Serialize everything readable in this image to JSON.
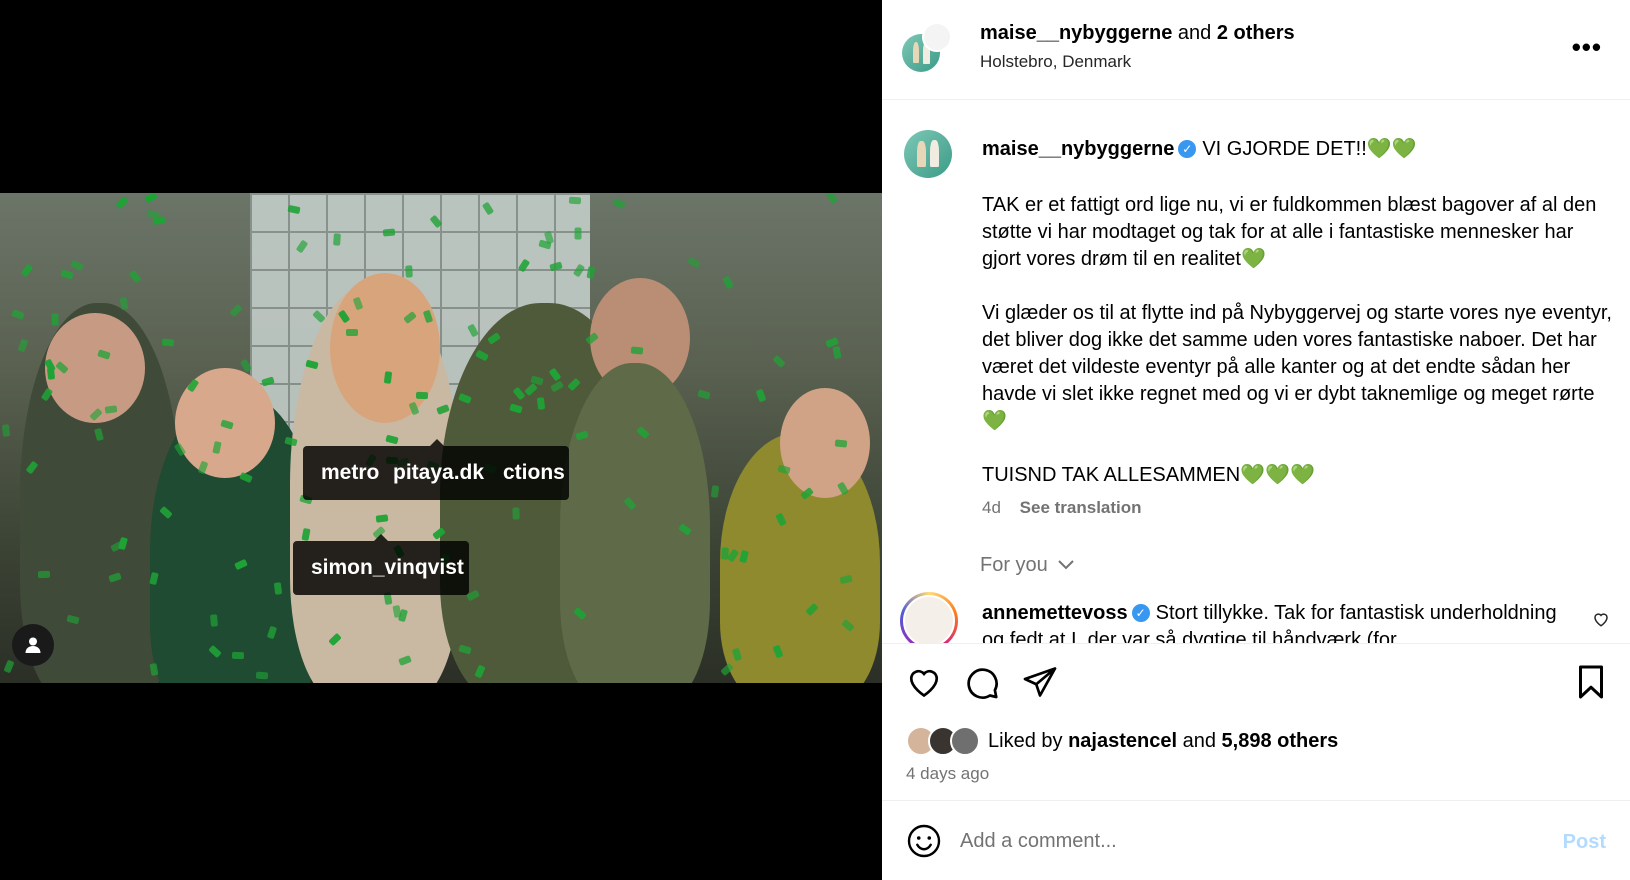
{
  "header": {
    "username": "maise__nybyggerne",
    "and_text": "and",
    "others": "2 others",
    "location": "Holstebro, Denmark"
  },
  "media": {
    "tags": {
      "tag1": "metro",
      "tag2": "pitaya.dk",
      "tag3": "ctions",
      "tag4": "simon_vinqvist"
    }
  },
  "caption": {
    "username": "maise__nybyggerne",
    "headline": "VI GJORDE DET!!💚💚",
    "body": "TAK er et fattigt ord lige nu, vi er fuldkommen blæst bagover af al den støtte vi har modtaget og tak for at alle i fantastiske mennesker har gjort vores drøm til en realitet💚\n\nVi glæder os til at flytte ind på Nybyggervej og starte vores nye eventyr, det bliver dog ikke det samme uden vores fantastiske naboer. Det har været det vildeste eventyr på alle kanter og at det endte sådan her havde vi slet ikke regnet med og vi er dybt taknemlige og meget rørte 💚\n\nTUISND TAK ALLESAMMEN💚💚💚",
    "age": "4d",
    "see_translation": "See translation"
  },
  "for_you": "For you",
  "comment": {
    "username": "annemettevoss",
    "text": "Stort tillykke. Tak for fantastisk underholdning og fedt at I, der var så dygtige til håndværk (for"
  },
  "likes": {
    "liked_by": "Liked by",
    "user": "najastencel",
    "and_text": "and",
    "others": "5,898 others"
  },
  "posted": "4 days ago",
  "add_comment": {
    "placeholder": "Add a comment...",
    "post": "Post"
  },
  "colors": {
    "verified": "#3897f0",
    "post_disabled": "#b3dbff",
    "confetti": "#1fa336"
  }
}
